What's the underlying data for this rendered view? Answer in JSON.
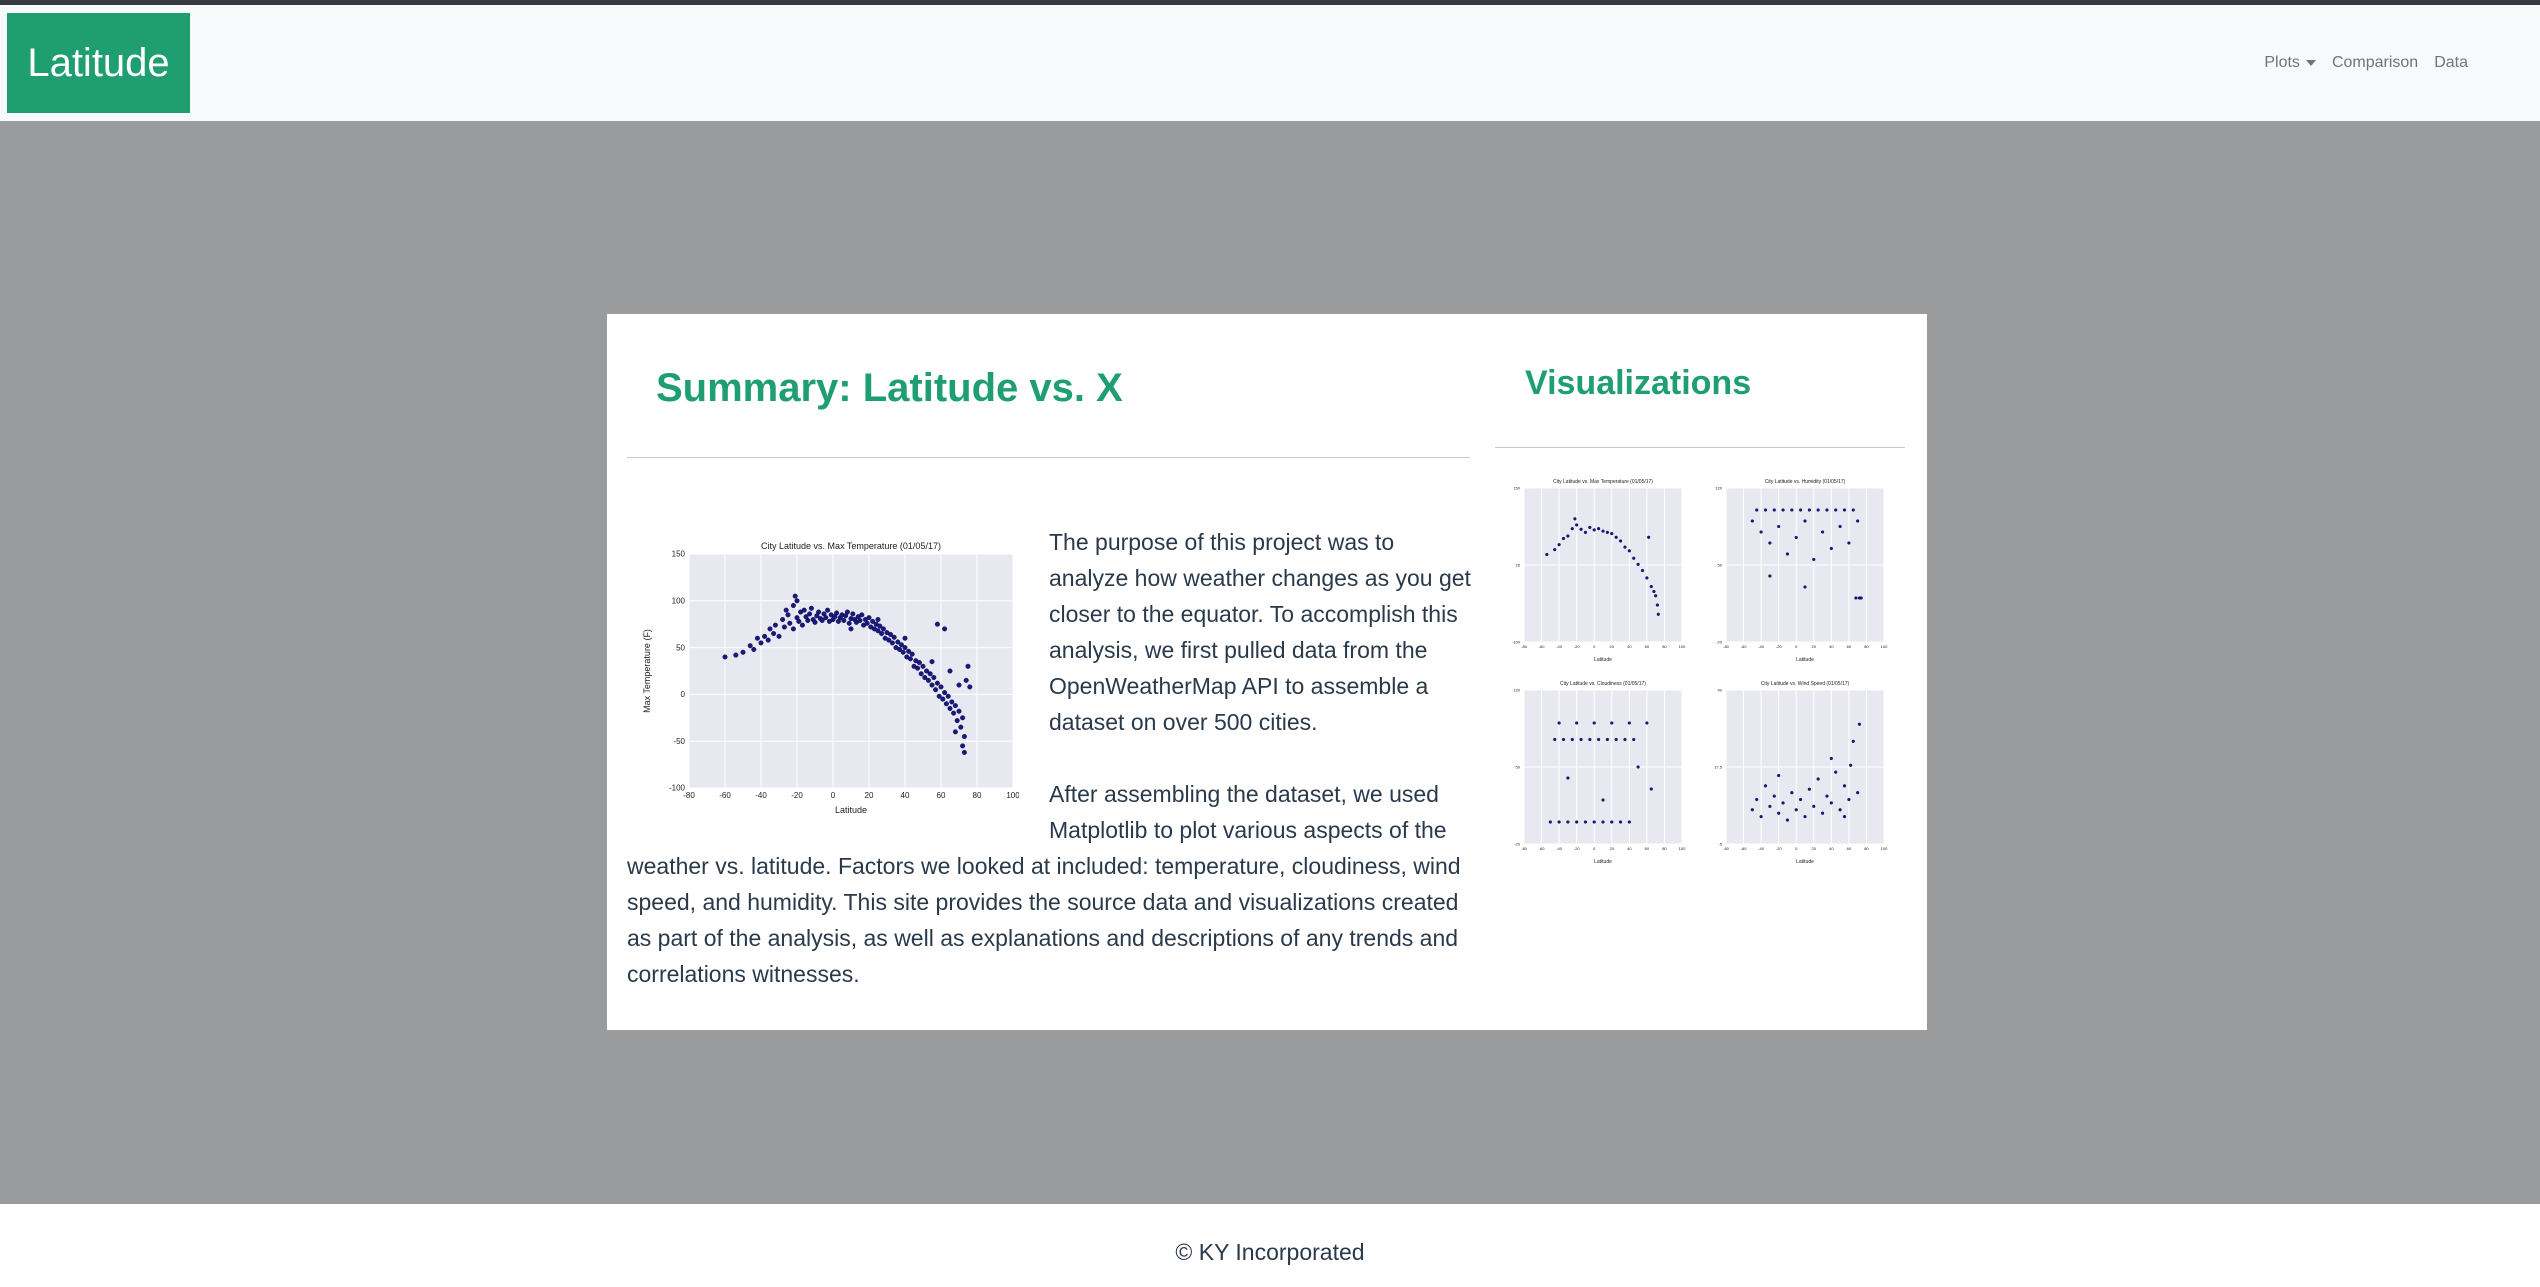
{
  "navbar": {
    "brand": "Latitude",
    "links": [
      {
        "label": "Plots",
        "dropdown": true
      },
      {
        "label": "Comparison",
        "dropdown": false
      },
      {
        "label": "Data",
        "dropdown": false
      }
    ]
  },
  "summary": {
    "title": "Summary: Latitude vs. X",
    "paragraph1": "The purpose of this project was to analyze how weather changes as you get closer to the equator. To accomplish this analysis, we first pulled data from the OpenWeatherMap API to assemble a dataset on over 500 cities.",
    "paragraph2": "After assembling the dataset, we used Matplotlib to plot various aspects of the weather vs. latitude. Factors we looked at included: temperature, cloudiness, wind speed, and humidity. This site provides the source data and visualizations created as part of the analysis, as well as explanations and descriptions of any trends and correlations witnesses."
  },
  "visualizations": {
    "title": "Visualizations"
  },
  "footer": {
    "text": "© KY Incorporated"
  },
  "colors": {
    "accent": "#1f9e72",
    "page_bg": "#9a9b9d",
    "marker": "#1a1a7a",
    "plot_bg": "#e8e8f0"
  },
  "chart_data": [
    {
      "type": "scatter",
      "title": "City Latitude vs. Max Temperature (01/05/17)",
      "xlabel": "Latitude",
      "ylabel": "Max Temperature (F)",
      "xlim": [
        -80,
        100
      ],
      "ylim": [
        -100,
        150
      ],
      "xticks": [
        -80,
        -60,
        -40,
        -20,
        0,
        20,
        40,
        60,
        80,
        100
      ],
      "yticks": [
        -100,
        -50,
        0,
        50,
        100,
        150
      ],
      "grid": true,
      "points": [
        [
          -54,
          42
        ],
        [
          -50,
          45
        ],
        [
          -46,
          52
        ],
        [
          -44,
          48
        ],
        [
          -42,
          60
        ],
        [
          -40,
          55
        ],
        [
          -38,
          62
        ],
        [
          -36,
          58
        ],
        [
          -35,
          70
        ],
        [
          -33,
          65
        ],
        [
          -32,
          74
        ],
        [
          -30,
          62
        ],
        [
          -28,
          80
        ],
        [
          -27,
          72
        ],
        [
          -25,
          85
        ],
        [
          -24,
          76
        ],
        [
          -22,
          95
        ],
        [
          -22,
          70
        ],
        [
          -21,
          105
        ],
        [
          -20,
          82
        ],
        [
          -19,
          78
        ],
        [
          -18,
          88
        ],
        [
          -17,
          74
        ],
        [
          -16,
          90
        ],
        [
          -15,
          83
        ],
        [
          -14,
          79
        ],
        [
          -13,
          86
        ],
        [
          -12,
          92
        ],
        [
          -11,
          80
        ],
        [
          -10,
          77
        ],
        [
          -9,
          84
        ],
        [
          -8,
          88
        ],
        [
          -7,
          81
        ],
        [
          -6,
          79
        ],
        [
          -5,
          86
        ],
        [
          -4,
          82
        ],
        [
          -3,
          90
        ],
        [
          -2,
          78
        ],
        [
          -1,
          85
        ],
        [
          0,
          80
        ],
        [
          1,
          83
        ],
        [
          2,
          87
        ],
        [
          3,
          78
        ],
        [
          4,
          82
        ],
        [
          5,
          85
        ],
        [
          6,
          79
        ],
        [
          7,
          84
        ],
        [
          8,
          88
        ],
        [
          9,
          76
        ],
        [
          10,
          81
        ],
        [
          11,
          86
        ],
        [
          12,
          80
        ],
        [
          13,
          77
        ],
        [
          14,
          83
        ],
        [
          15,
          79
        ],
        [
          16,
          85
        ],
        [
          17,
          74
        ],
        [
          18,
          80
        ],
        [
          19,
          76
        ],
        [
          20,
          82
        ],
        [
          21,
          72
        ],
        [
          22,
          78
        ],
        [
          23,
          70
        ],
        [
          24,
          75
        ],
        [
          25,
          68
        ],
        [
          26,
          73
        ],
        [
          27,
          65
        ],
        [
          28,
          70
        ],
        [
          29,
          60
        ],
        [
          30,
          66
        ],
        [
          31,
          58
        ],
        [
          32,
          64
        ],
        [
          33,
          55
        ],
        [
          34,
          61
        ],
        [
          35,
          50
        ],
        [
          36,
          56
        ],
        [
          37,
          48
        ],
        [
          38,
          53
        ],
        [
          39,
          45
        ],
        [
          40,
          50
        ],
        [
          41,
          40
        ],
        [
          42,
          46
        ],
        [
          43,
          38
        ],
        [
          44,
          43
        ],
        [
          45,
          30
        ],
        [
          46,
          36
        ],
        [
          47,
          28
        ],
        [
          48,
          34
        ],
        [
          49,
          22
        ],
        [
          50,
          30
        ],
        [
          51,
          18
        ],
        [
          52,
          25
        ],
        [
          53,
          15
        ],
        [
          54,
          22
        ],
        [
          55,
          10
        ],
        [
          56,
          18
        ],
        [
          57,
          5
        ],
        [
          58,
          12
        ],
        [
          59,
          -2
        ],
        [
          60,
          8
        ],
        [
          61,
          -5
        ],
        [
          62,
          2
        ],
        [
          63,
          -10
        ],
        [
          64,
          -2
        ],
        [
          65,
          -15
        ],
        [
          66,
          -8
        ],
        [
          67,
          -20
        ],
        [
          68,
          -12
        ],
        [
          69,
          -28
        ],
        [
          70,
          -18
        ],
        [
          71,
          -35
        ],
        [
          72,
          -25
        ],
        [
          73,
          -45
        ],
        [
          72,
          -55
        ],
        [
          73,
          -62
        ],
        [
          74,
          15
        ],
        [
          75,
          30
        ],
        [
          76,
          8
        ],
        [
          62,
          70
        ],
        [
          58,
          75
        ],
        [
          -20,
          100
        ],
        [
          -26,
          90
        ],
        [
          -60,
          40
        ],
        [
          10,
          70
        ],
        [
          25,
          80
        ],
        [
          40,
          60
        ],
        [
          55,
          35
        ],
        [
          65,
          25
        ],
        [
          70,
          10
        ],
        [
          68,
          -40
        ]
      ]
    },
    {
      "type": "scatter",
      "title": "City Latitude vs. Max Temperature (01/05/17)",
      "xlabel": "Latitude",
      "points": [
        [
          -54,
          42
        ],
        [
          -45,
          50
        ],
        [
          -35,
          68
        ],
        [
          -30,
          72
        ],
        [
          -25,
          84
        ],
        [
          -20,
          90
        ],
        [
          -15,
          83
        ],
        [
          -10,
          78
        ],
        [
          -5,
          86
        ],
        [
          0,
          82
        ],
        [
          5,
          84
        ],
        [
          10,
          80
        ],
        [
          15,
          78
        ],
        [
          20,
          76
        ],
        [
          25,
          70
        ],
        [
          30,
          64
        ],
        [
          35,
          54
        ],
        [
          40,
          48
        ],
        [
          45,
          36
        ],
        [
          50,
          26
        ],
        [
          55,
          16
        ],
        [
          60,
          4
        ],
        [
          65,
          -10
        ],
        [
          68,
          -18
        ],
        [
          70,
          -25
        ],
        [
          72,
          -40
        ],
        [
          73,
          -55
        ],
        [
          62,
          70
        ],
        [
          -22,
          100
        ],
        [
          -40,
          58
        ]
      ]
    },
    {
      "type": "scatter",
      "title": "City Latitude vs. Humidity (01/05/17)",
      "xlabel": "Latitude",
      "points": [
        [
          -50,
          90
        ],
        [
          -45,
          100
        ],
        [
          -40,
          80
        ],
        [
          -35,
          100
        ],
        [
          -30,
          70
        ],
        [
          -25,
          100
        ],
        [
          -20,
          85
        ],
        [
          -15,
          100
        ],
        [
          -10,
          60
        ],
        [
          -5,
          100
        ],
        [
          0,
          75
        ],
        [
          5,
          100
        ],
        [
          10,
          90
        ],
        [
          15,
          100
        ],
        [
          20,
          55
        ],
        [
          25,
          100
        ],
        [
          30,
          80
        ],
        [
          35,
          100
        ],
        [
          40,
          65
        ],
        [
          45,
          100
        ],
        [
          50,
          85
        ],
        [
          55,
          100
        ],
        [
          60,
          70
        ],
        [
          65,
          100
        ],
        [
          70,
          90
        ],
        [
          72,
          20
        ],
        [
          74,
          20
        ],
        [
          68,
          20
        ],
        [
          -30,
          40
        ],
        [
          10,
          30
        ]
      ]
    },
    {
      "type": "scatter",
      "title": "City Latitude vs. Cloudiness (01/05/17)",
      "xlabel": "Latitude",
      "points": [
        [
          -50,
          0
        ],
        [
          -40,
          0
        ],
        [
          -30,
          0
        ],
        [
          -20,
          0
        ],
        [
          -10,
          0
        ],
        [
          0,
          0
        ],
        [
          10,
          0
        ],
        [
          20,
          0
        ],
        [
          30,
          0
        ],
        [
          40,
          0
        ],
        [
          -45,
          75
        ],
        [
          -35,
          75
        ],
        [
          -25,
          75
        ],
        [
          -15,
          75
        ],
        [
          -5,
          75
        ],
        [
          5,
          75
        ],
        [
          15,
          75
        ],
        [
          25,
          75
        ],
        [
          35,
          75
        ],
        [
          45,
          75
        ],
        [
          -40,
          90
        ],
        [
          -20,
          90
        ],
        [
          0,
          90
        ],
        [
          20,
          90
        ],
        [
          40,
          90
        ],
        [
          60,
          90
        ],
        [
          -30,
          40
        ],
        [
          10,
          20
        ],
        [
          50,
          50
        ],
        [
          65,
          30
        ]
      ]
    },
    {
      "type": "scatter",
      "title": "City Latitude vs. Wind Speed (01/05/17)",
      "xlabel": "Latitude",
      "points": [
        [
          -50,
          5
        ],
        [
          -45,
          8
        ],
        [
          -40,
          3
        ],
        [
          -35,
          12
        ],
        [
          -30,
          6
        ],
        [
          -25,
          9
        ],
        [
          -20,
          4
        ],
        [
          -15,
          7
        ],
        [
          -10,
          2
        ],
        [
          -5,
          10
        ],
        [
          0,
          5
        ],
        [
          5,
          8
        ],
        [
          10,
          3
        ],
        [
          15,
          11
        ],
        [
          20,
          6
        ],
        [
          25,
          14
        ],
        [
          30,
          4
        ],
        [
          35,
          9
        ],
        [
          40,
          7
        ],
        [
          45,
          16
        ],
        [
          50,
          5
        ],
        [
          55,
          12
        ],
        [
          60,
          8
        ],
        [
          65,
          25
        ],
        [
          70,
          10
        ],
        [
          72,
          30
        ],
        [
          40,
          20
        ],
        [
          -20,
          15
        ],
        [
          55,
          3
        ],
        [
          62,
          18
        ]
      ]
    }
  ]
}
